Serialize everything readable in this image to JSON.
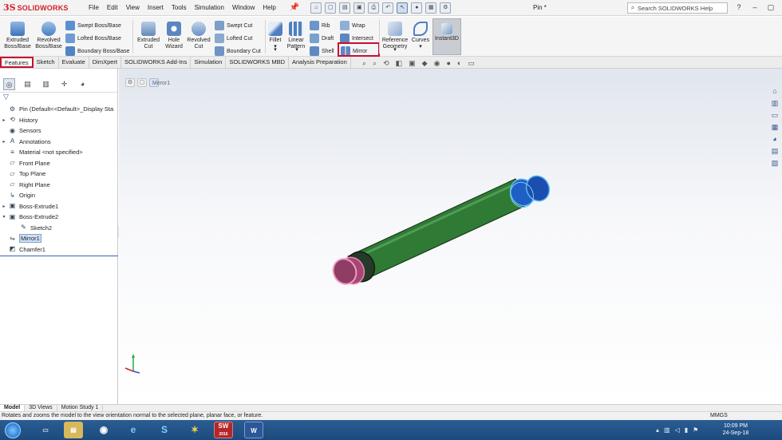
{
  "app": {
    "logo_ds": "3S",
    "logo_text": "SOLIDWORKS",
    "document_title": "Pin *",
    "search_placeholder": "Search SOLIDWORKS Help"
  },
  "menu": [
    "File",
    "Edit",
    "View",
    "Insert",
    "Tools",
    "Simulation",
    "Window",
    "Help"
  ],
  "ribbon": {
    "extruded_boss": [
      "Extruded",
      "Boss/Base"
    ],
    "revolved_boss": [
      "Revolved",
      "Boss/Base"
    ],
    "swept_boss": "Swept Boss/Base",
    "lofted_boss": "Lofted Boss/Base",
    "boundary_boss": "Boundary Boss/Base",
    "extruded_cut": [
      "Extruded",
      "Cut"
    ],
    "hole_wizard": [
      "Hole",
      "Wizard"
    ],
    "revolved_cut": [
      "Revolved",
      "Cut"
    ],
    "swept_cut": "Swept Cut",
    "lofted_cut": "Lofted Cut",
    "boundary_cut": "Boundary Cut",
    "fillet": "Fillet",
    "linear_pattern": [
      "Linear",
      "Pattern"
    ],
    "rib": "Rib",
    "draft": "Draft",
    "shell": "Shell",
    "wrap": "Wrap",
    "intersect": "Intersect",
    "mirror": "Mirror",
    "reference_geometry": [
      "Reference",
      "Geometry"
    ],
    "curves": "Curves",
    "instant3d": "Instant3D"
  },
  "tabs": [
    "Features",
    "Sketch",
    "Evaluate",
    "DimXpert",
    "SOLIDWORKS Add-Ins",
    "Simulation",
    "SOLIDWORKS MBD",
    "Analysis Preparation"
  ],
  "tree": [
    {
      "label": "Pin  (Default<<Default>_Display Sta",
      "arrow": "",
      "icon": "⚙"
    },
    {
      "label": "History",
      "arrow": "▸",
      "icon": "⟲"
    },
    {
      "label": "Sensors",
      "arrow": "",
      "icon": "◉"
    },
    {
      "label": "Annotations",
      "arrow": "▸",
      "icon": "A"
    },
    {
      "label": "Material <not specified>",
      "arrow": "",
      "icon": "≡"
    },
    {
      "label": "Front Plane",
      "arrow": "",
      "icon": "▱"
    },
    {
      "label": "Top Plane",
      "arrow": "",
      "icon": "▱"
    },
    {
      "label": "Right Plane",
      "arrow": "",
      "icon": "▱"
    },
    {
      "label": "Origin",
      "arrow": "",
      "icon": "↳"
    },
    {
      "label": "Boss-Extrude1",
      "arrow": "▸",
      "icon": "▣"
    },
    {
      "label": "Boss-Extrude2",
      "arrow": "▾",
      "icon": "▣"
    },
    {
      "label": "Sketch2",
      "arrow": "",
      "icon": "✎"
    },
    {
      "label": "Mirror1",
      "arrow": "",
      "icon": "⇋"
    },
    {
      "label": "Chamfer1",
      "arrow": "",
      "icon": "◩"
    }
  ],
  "breadcrumb": {
    "item": "Mirror1"
  },
  "bottom_tabs": [
    "Model",
    "3D Views",
    "Motion Study 1"
  ],
  "status": {
    "message": "Rotates and zooms the model to the view orientation normal to the selected plane, planar face, or feature.",
    "units": "MMGS"
  },
  "taskbar": {
    "time": "10:09 PM",
    "date": "24-Sep-18",
    "sw_label": "SW",
    "sw_year": "2016",
    "word_label": "W"
  },
  "colors": {
    "shaft": "#2f7a35",
    "left_end": "#c4517f",
    "right_end": "#1f5fc4",
    "highlight": "#c8102e"
  }
}
